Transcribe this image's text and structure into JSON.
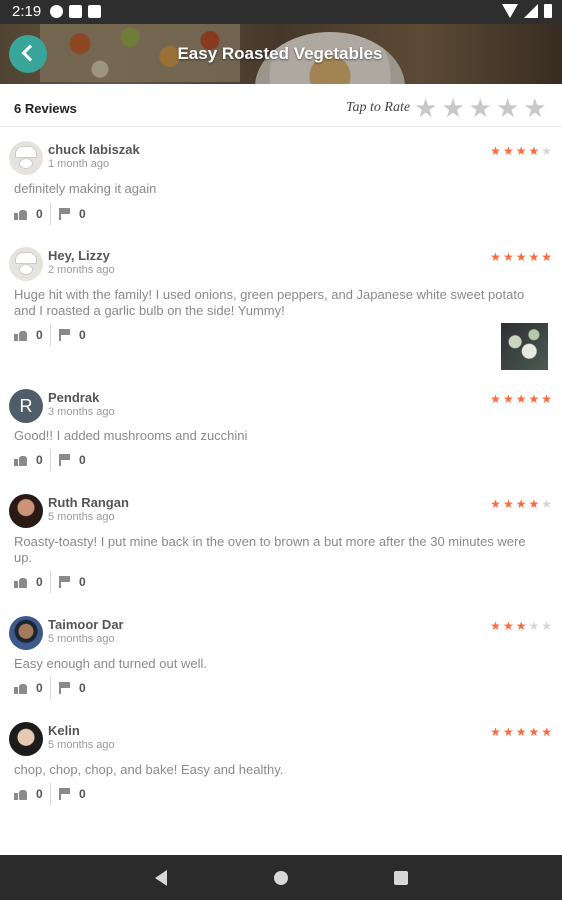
{
  "status": {
    "time": "2:19"
  },
  "header": {
    "title": "Easy Roasted Vegetables"
  },
  "reviews_header": {
    "count_label": "6 Reviews",
    "tap_to_rate": "Tap to Rate",
    "rate_stars": 5
  },
  "reviews": [
    {
      "name": "chuck labiszak",
      "time": "1 month ago",
      "rating": 4,
      "text": "definitely making it again",
      "likes": "0",
      "flags": "0",
      "avatar": "chef-hat"
    },
    {
      "name": "Hey, Lizzy",
      "time": "2 months ago",
      "rating": 5,
      "text": "Huge hit with the family! I used onions, green peppers, and Japanese white sweet potato and I roasted a garlic bulb on the side! Yummy!",
      "likes": "0",
      "flags": "0",
      "avatar": "chef-hat",
      "has_photo": true
    },
    {
      "name": "Pendrak",
      "time": "3 months ago",
      "rating": 5,
      "text": "Good!! I added mushrooms and zucchini",
      "likes": "0",
      "flags": "0",
      "avatar": "letter",
      "initial": "R"
    },
    {
      "name": "Ruth Rangan",
      "time": "5 months ago",
      "rating": 4,
      "text": "Roasty-toasty! I put mine back in the oven to brown a but more after the 30 minutes were up.",
      "likes": "0",
      "flags": "0",
      "avatar": "photo"
    },
    {
      "name": "Taimoor Dar",
      "time": "5 months ago",
      "rating": 3,
      "text": "Easy enough and turned out well.",
      "likes": "0",
      "flags": "0",
      "avatar": "photo"
    },
    {
      "name": "Kelin",
      "time": "5 months ago",
      "rating": 5,
      "text": "chop, chop, chop, and bake! Easy and healthy.",
      "likes": "0",
      "flags": "0",
      "avatar": "photo"
    }
  ],
  "colors": {
    "accent": "#3aa59a",
    "star_on": "#ff6a3d",
    "star_off": "#d6d6d6"
  }
}
